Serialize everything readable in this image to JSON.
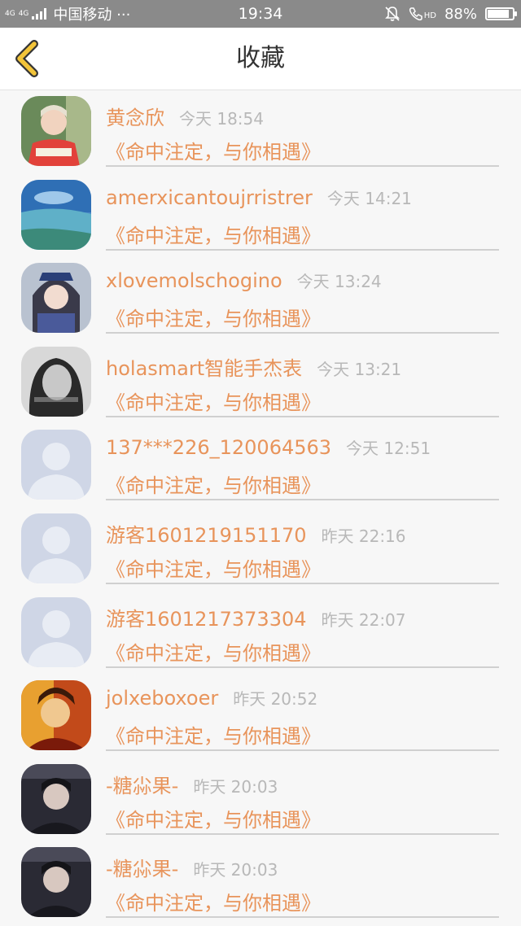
{
  "status_bar": {
    "network_top": "4G",
    "network_bottom": "4G",
    "carrier": "中国移动 ···",
    "time": "19:34",
    "hd": "HD",
    "battery": "88%",
    "battery_level": 0.88
  },
  "nav": {
    "title": "收藏"
  },
  "items": [
    {
      "username": "黄念欣",
      "time": "今天 18:54",
      "title": "《命中注定，与你相遇》",
      "avatar": "photo-girl-apric"
    },
    {
      "username": "amerxicantoujrristrer",
      "time": "今天 14:21",
      "title": "《命中注定，与你相遇》",
      "avatar": "photo-sea"
    },
    {
      "username": "xlovemolschogino",
      "time": "今天 13:24",
      "title": "《命中注定，与你相遇》",
      "avatar": "photo-anime"
    },
    {
      "username": "holasmart智能手杰表",
      "time": "今天 13:21",
      "title": "《命中注定，与你相遇》",
      "avatar": "photo-bw-girl"
    },
    {
      "username": "137***226_120064563",
      "time": "今天 12:51",
      "title": "《命中注定，与你相遇》",
      "avatar": "default-avatar"
    },
    {
      "username": "游客1601219151170",
      "time": "昨天 22:16",
      "title": "《命中注定，与你相遇》",
      "avatar": "default-avatar"
    },
    {
      "username": "游客1601217373304",
      "time": "昨天 22:07",
      "title": "《命中注定，与你相遇》",
      "avatar": "default-avatar"
    },
    {
      "username": "jolxeboxoer",
      "time": "昨天 20:52",
      "title": "《命中注定，与你相遇》",
      "avatar": "photo-colorful"
    },
    {
      "username": "-糖尛果-",
      "time": "昨天 20:03",
      "title": "《命中注定，与你相遇》",
      "avatar": "photo-dark-boy"
    },
    {
      "username": "-糖尛果-",
      "time": "昨天 20:03",
      "title": "《命中注定，与你相遇》",
      "avatar": "photo-dark-boy"
    }
  ],
  "colors": {
    "accent": "#e8945b",
    "back_icon": "#f2c43a",
    "status_bar": "#8a8a8a",
    "timestamp": "#b8b8b8"
  }
}
